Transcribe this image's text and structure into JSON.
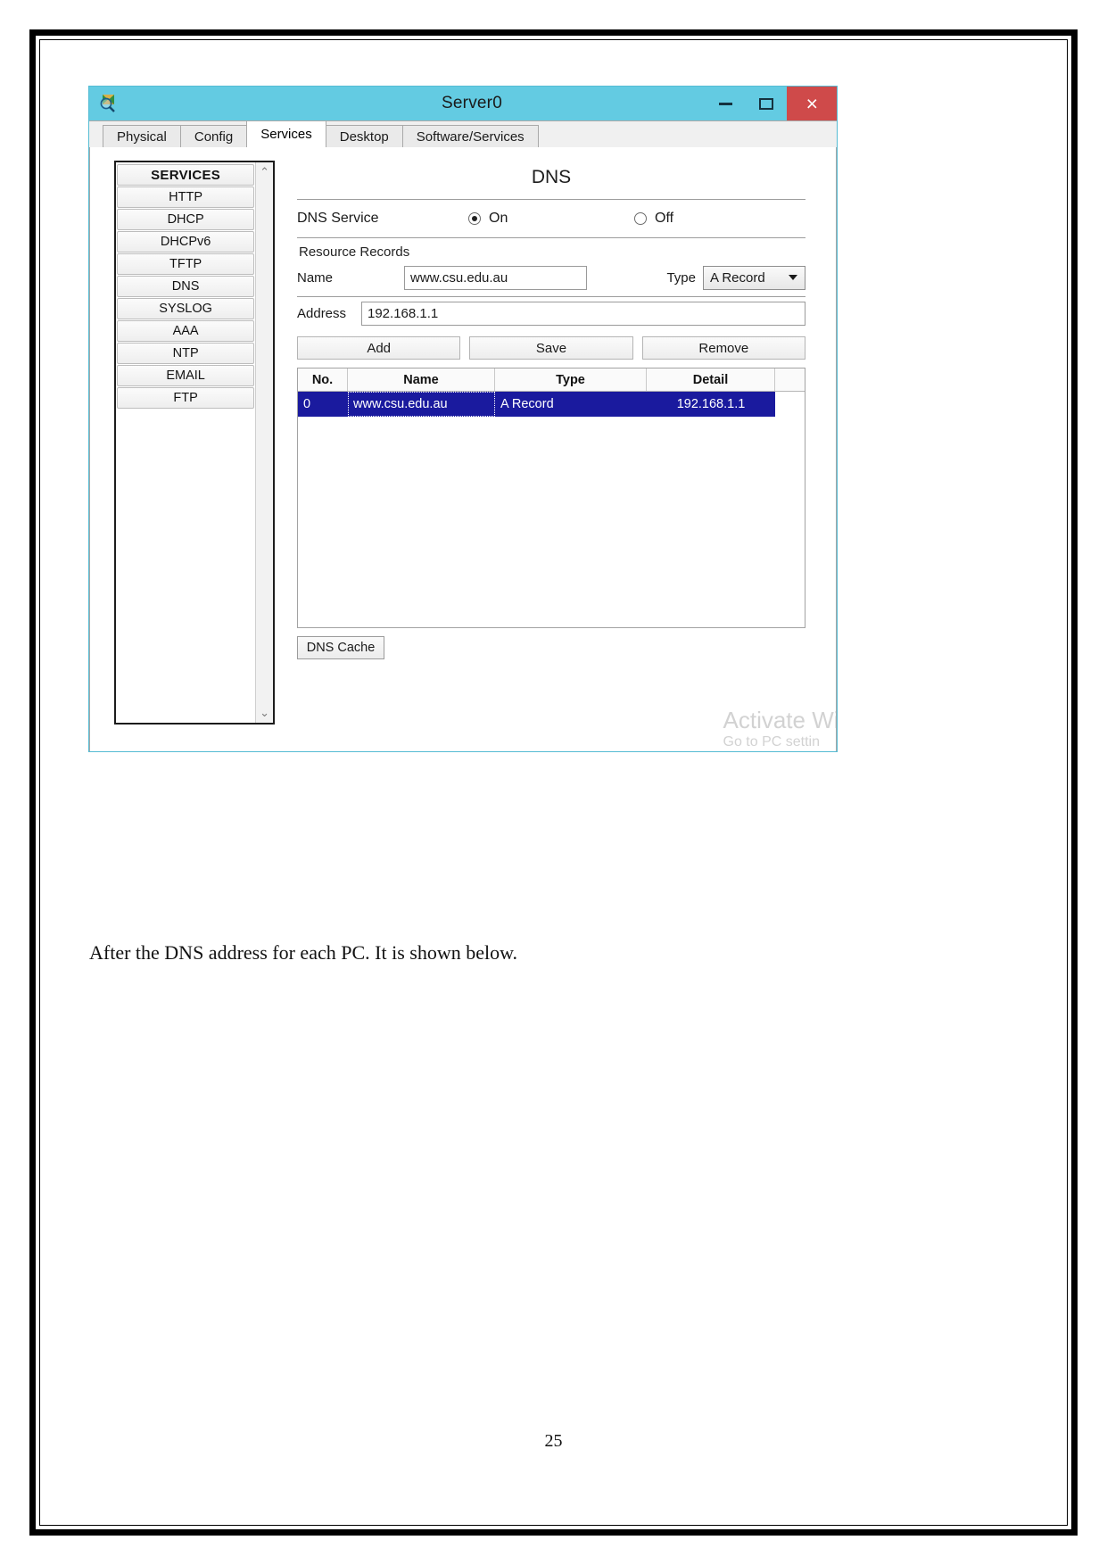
{
  "document": {
    "caption": "After the DNS address for each PC. It is shown below.",
    "page_number": "25"
  },
  "window": {
    "title": "Server0",
    "icon": "packet-tracer-icon",
    "controls": {
      "minimize": "minimize-icon",
      "maximize": "maximize-icon",
      "close": "×"
    },
    "close_color": "#cf4a4a",
    "titlebar_color": "#63cbe2"
  },
  "tabs": [
    {
      "label": "Physical",
      "active": false
    },
    {
      "label": "Config",
      "active": false
    },
    {
      "label": "Services",
      "active": true
    },
    {
      "label": "Desktop",
      "active": false
    },
    {
      "label": "Software/Services",
      "active": false
    }
  ],
  "sidebar": {
    "header": "SERVICES",
    "items": [
      {
        "label": "HTTP"
      },
      {
        "label": "DHCP"
      },
      {
        "label": "DHCPv6"
      },
      {
        "label": "TFTP"
      },
      {
        "label": "DNS"
      },
      {
        "label": "SYSLOG"
      },
      {
        "label": "AAA"
      },
      {
        "label": "NTP"
      },
      {
        "label": "EMAIL"
      },
      {
        "label": "FTP"
      }
    ],
    "scroll_up": "⌃",
    "scroll_down": "⌄"
  },
  "dns": {
    "panel_title": "DNS",
    "service_label": "DNS Service",
    "service_on_label": "On",
    "service_off_label": "Off",
    "service_state": "On",
    "resource_records_label": "Resource Records",
    "name_label": "Name",
    "name_value": "www.csu.edu.au",
    "type_label": "Type",
    "type_value": "A Record",
    "address_label": "Address",
    "address_value": "192.168.1.1",
    "buttons": {
      "add": "Add",
      "save": "Save",
      "remove": "Remove"
    },
    "table": {
      "columns": [
        "No.",
        "Name",
        "Type",
        "Detail"
      ],
      "rows": [
        {
          "no": "0",
          "name": "www.csu.edu.au",
          "type": "A Record",
          "detail": "192.168.1.1",
          "selected": true
        }
      ],
      "selected_row_color": "#1a1a9e"
    },
    "cache_button": "DNS Cache"
  },
  "watermark": {
    "line1": "Activate Win",
    "line2": "Go to PC settin"
  }
}
